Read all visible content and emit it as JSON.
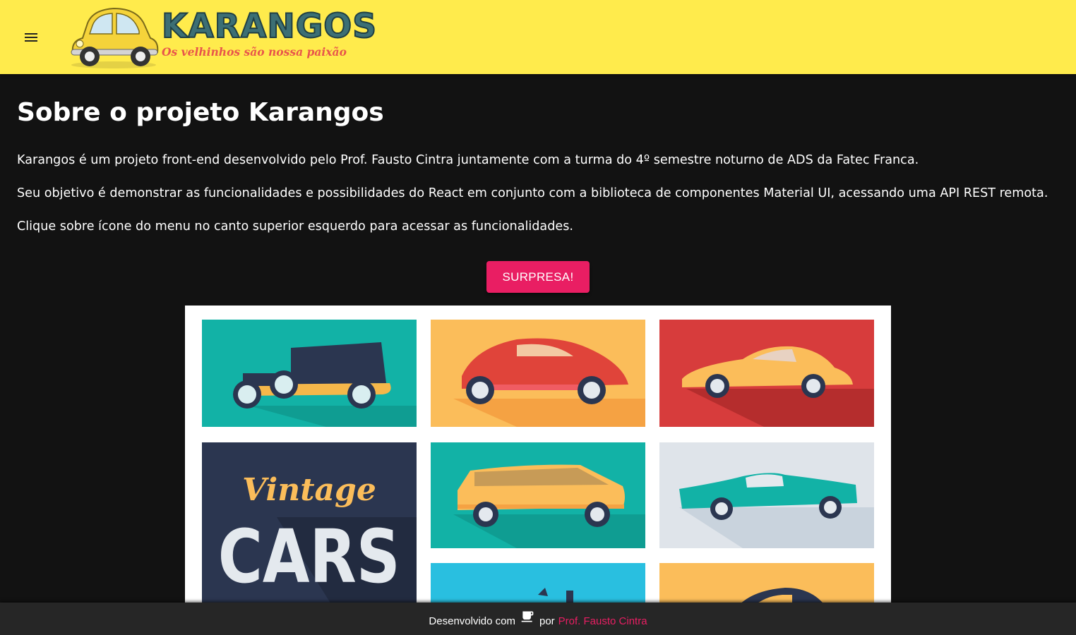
{
  "header": {
    "brand_name": "KARANGOS",
    "tagline": "Os velhinhos são nossa paixão",
    "colors": {
      "appbar": "#ffeb4c",
      "brand": "#3c6f74",
      "tagline": "#e8564b"
    }
  },
  "main": {
    "title": "Sobre o projeto Karangos",
    "paragraphs": [
      "Karangos é um projeto front-end desenvolvido pelo Prof. Fausto Cintra juntamente com a turma do 4º semestre noturno de ADS da Fatec Franca.",
      "Seu objetivo é demonstrar as funcionalidades e possibilidades do React em conjunto com a biblioteca de componentes Material UI, acessando uma API REST remota.",
      "Clique sobre ícone do menu no canto superior esquerdo para acessar as funcionalidades."
    ],
    "surprise_button": "SURPRESA!",
    "image": {
      "title_script": "Vintage",
      "title_block": "CARS"
    }
  },
  "footer": {
    "prefix": "Desenvolvido com",
    "icon": "coffee-icon",
    "by": "por",
    "author_link": "Prof. Fausto Cintra",
    "colors": {
      "link": "#e91e63",
      "background": "#262626"
    }
  },
  "theme": {
    "background": "#121212",
    "accent": "#e91e63"
  }
}
